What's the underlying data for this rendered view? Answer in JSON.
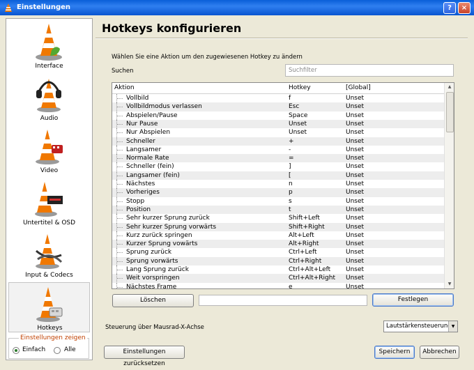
{
  "window": {
    "title": "Einstellungen",
    "help_glyph": "?",
    "close_glyph": "×"
  },
  "sidebar": {
    "items": [
      {
        "label": "Interface",
        "icon": "vlc-cone-icon"
      },
      {
        "label": "Audio",
        "icon": "vlc-cone-headphones-icon"
      },
      {
        "label": "Video",
        "icon": "vlc-cone-film-icon"
      },
      {
        "label": "Untertitel & OSD",
        "icon": "vlc-cone-subtitles-icon"
      },
      {
        "label": "Input & Codecs",
        "icon": "vlc-cone-cables-icon"
      },
      {
        "label": "Hotkeys",
        "icon": "vlc-cone-keyboard-icon"
      }
    ],
    "selected_index": 5,
    "show_settings": {
      "legend": "Einstellungen zeigen",
      "option_simple": "Einfach",
      "option_all": "Alle",
      "selected": "Einfach"
    }
  },
  "main": {
    "title": "Hotkeys konfigurieren",
    "instruction": "Wählen Sie eine Aktion um den zugewiesenen Hotkey zu ändern",
    "search_label": "Suchen",
    "search_placeholder": "Suchfilter",
    "table": {
      "headers": [
        "Aktion",
        "Hotkey",
        "[Global]"
      ],
      "rows": [
        [
          "Vollbild",
          "f",
          "Unset"
        ],
        [
          "Vollbildmodus verlassen",
          "Esc",
          "Unset"
        ],
        [
          "Abspielen/Pause",
          "Space",
          "Unset"
        ],
        [
          "Nur Pause",
          "Unset",
          "Unset"
        ],
        [
          "Nur Abspielen",
          "Unset",
          "Unset"
        ],
        [
          "Schneller",
          "+",
          "Unset"
        ],
        [
          "Langsamer",
          "-",
          "Unset"
        ],
        [
          "Normale Rate",
          "=",
          "Unset"
        ],
        [
          "Schneller (fein)",
          "]",
          "Unset"
        ],
        [
          "Langsamer (fein)",
          "[",
          "Unset"
        ],
        [
          "Nächstes",
          "n",
          "Unset"
        ],
        [
          "Vorheriges",
          "p",
          "Unset"
        ],
        [
          "Stopp",
          "s",
          "Unset"
        ],
        [
          "Position",
          "t",
          "Unset"
        ],
        [
          "Sehr kurzer Sprung zurück",
          "Shift+Left",
          "Unset"
        ],
        [
          "Sehr kurzer Sprung vorwärts",
          "Shift+Right",
          "Unset"
        ],
        [
          "Kurz zurück springen",
          "Alt+Left",
          "Unset"
        ],
        [
          "Kurzer Sprung vowärts",
          "Alt+Right",
          "Unset"
        ],
        [
          "Sprung zurück",
          "Ctrl+Left",
          "Unset"
        ],
        [
          "Sprung vorwärts",
          "Ctrl+Right",
          "Unset"
        ],
        [
          "Lang Sprung zurück",
          "Ctrl+Alt+Left",
          "Unset"
        ],
        [
          "Weit vorspringen",
          "Ctrl+Alt+Right",
          "Unset"
        ],
        [
          "Nächstes Frame",
          "e",
          "Unset"
        ]
      ]
    },
    "clear_button": "Löschen",
    "hotkey_field_value": "",
    "set_button": "Festlegen",
    "mousewheel_label": "Steuerung über Mausrad-X-Achse",
    "mousewheel_value": "Lautstärkensteuerung",
    "reset_button": "Einstellungen zurücksetzen",
    "save_button": "Speichern",
    "cancel_button": "Abbrechen"
  },
  "colors": {
    "titlebar": "#0a5fd8",
    "cone_orange": "#f07800",
    "legend_text": "#c04000"
  }
}
